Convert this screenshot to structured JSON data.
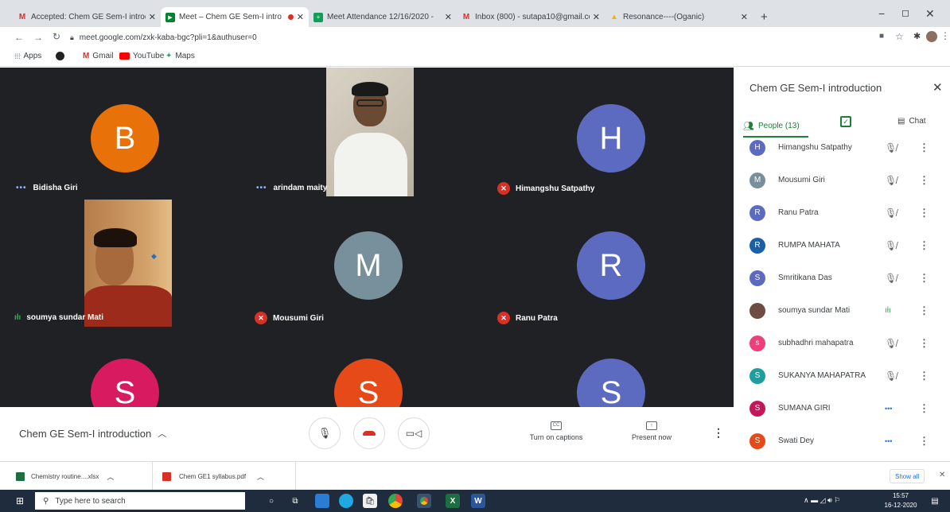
{
  "browser": {
    "tabs": [
      {
        "title": "Accepted: Chem GE Sem-I introd",
        "icon": "gmail-icon",
        "active": false
      },
      {
        "title": "Meet – Chem GE Sem-I intro",
        "icon": "meet-icon",
        "active": true
      },
      {
        "title": "Meet Attendance 12/16/2020 -",
        "icon": "sheets-icon",
        "active": false
      },
      {
        "title": "Inbox (800) - sutapa10@gmail.co",
        "icon": "gmail-icon",
        "active": false
      },
      {
        "title": "Resonance----(Oganic)",
        "icon": "drive-icon",
        "active": false
      }
    ],
    "url": "meet.google.com/zxk-kaba-bgc?pli=1&authuser=0",
    "bookmarks": [
      "Apps",
      "Gmail",
      "YouTube",
      "Maps"
    ]
  },
  "meeting": {
    "title": "Chem GE Sem-I introduction",
    "tiles": [
      {
        "name": "Bidisha Giri",
        "letter": "B",
        "color": "#e8710a",
        "status": "talking-dots",
        "kind": "avatar"
      },
      {
        "name": "arindam maity",
        "letter": "",
        "color": "",
        "status": "talking-dots",
        "kind": "video"
      },
      {
        "name": "Himangshu Satpathy",
        "letter": "H",
        "color": "#5c6bc0",
        "status": "muted",
        "kind": "avatar"
      },
      {
        "name": "soumya sundar Mati",
        "letter": "",
        "color": "",
        "status": "speaking",
        "kind": "video"
      },
      {
        "name": "Mousumi Giri",
        "letter": "M",
        "color": "#78909c",
        "status": "muted",
        "kind": "avatar"
      },
      {
        "name": "Ranu Patra",
        "letter": "R",
        "color": "#5c6bc0",
        "status": "muted",
        "kind": "avatar"
      },
      {
        "name": "",
        "letter": "S",
        "color": "#d81b60",
        "status": "",
        "kind": "avatar"
      },
      {
        "name": "",
        "letter": "S",
        "color": "#e64a19",
        "status": "",
        "kind": "avatar"
      },
      {
        "name": "",
        "letter": "S",
        "color": "#5c6bc0",
        "status": "",
        "kind": "avatar"
      }
    ],
    "controls": {
      "captions_label": "Turn on captions",
      "present_label": "Present now"
    }
  },
  "panel": {
    "title": "Chem GE Sem-I introduction",
    "people_tab": "People (13)",
    "chat_tab": "Chat",
    "people": [
      {
        "name": "Himangshu Satpathy",
        "letter": "H",
        "color": "#5c6bc0",
        "status": "muted"
      },
      {
        "name": "Mousumi Giri",
        "letter": "M",
        "color": "#78909c",
        "status": "muted"
      },
      {
        "name": "Ranu Patra",
        "letter": "R",
        "color": "#5c6bc0",
        "status": "muted"
      },
      {
        "name": "RUMPA MAHATA",
        "letter": "R",
        "color": "#1a5fa8",
        "status": "muted"
      },
      {
        "name": "Smritikana Das",
        "letter": "S",
        "color": "#5c6bc0",
        "status": "muted"
      },
      {
        "name": "soumya sundar Mati",
        "letter": "",
        "color": "#6d4c41",
        "status": "speaking"
      },
      {
        "name": "subhadhri mahapatra",
        "letter": "s",
        "color": "#ec407a",
        "status": "muted"
      },
      {
        "name": "SUKANYA MAHAPATRA",
        "letter": "S",
        "color": "#1e9e9e",
        "status": "muted"
      },
      {
        "name": "SUMANA GIRI",
        "letter": "S",
        "color": "#c2185b",
        "status": "dots"
      },
      {
        "name": "Swati Dey",
        "letter": "S",
        "color": "#e64a19",
        "status": "dots"
      }
    ]
  },
  "downloads": {
    "items": [
      "Chemistry routine....xlsx",
      "Chem GE1 syllabus.pdf"
    ],
    "show_all": "Show all"
  },
  "taskbar": {
    "search_placeholder": "Type here to search",
    "time": "15:57",
    "date": "16-12-2020"
  }
}
